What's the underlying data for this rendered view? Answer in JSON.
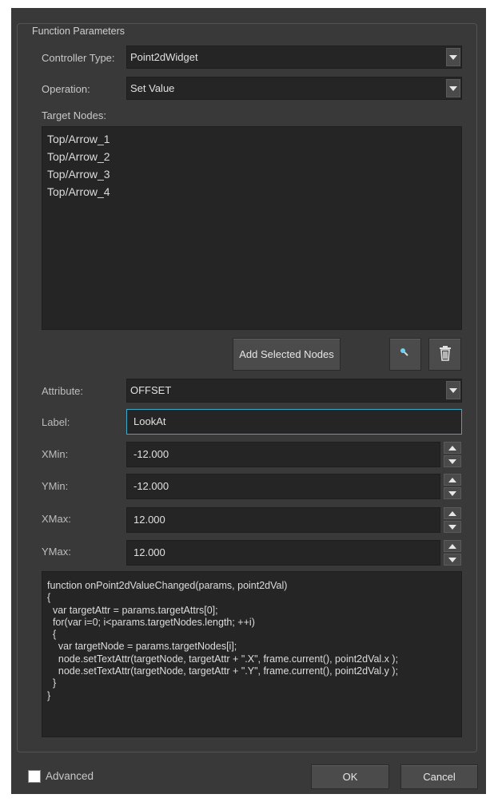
{
  "group": {
    "title": "Function Parameters"
  },
  "controller_type": {
    "label": "Controller Type:",
    "value": "Point2dWidget"
  },
  "operation": {
    "label": "Operation:",
    "value": "Set Value"
  },
  "target_nodes": {
    "label": "Target Nodes:",
    "items": [
      "Top/Arrow_1",
      "Top/Arrow_2",
      "Top/Arrow_3",
      "Top/Arrow_4"
    ]
  },
  "buttons": {
    "add_selected": "Add Selected Nodes",
    "pick_icon": "eyedropper-icon",
    "delete_icon": "trash-icon"
  },
  "attribute": {
    "label": "Attribute:",
    "value": "OFFSET"
  },
  "label_field": {
    "label": "Label:",
    "value": "LookAt"
  },
  "xmin": {
    "label": "XMin:",
    "value": "-12.000"
  },
  "ymin": {
    "label": "YMin:",
    "value": "-12.000"
  },
  "xmax": {
    "label": "XMax:",
    "value": "12.000"
  },
  "ymax": {
    "label": "YMax:",
    "value": "12.000"
  },
  "script": {
    "code": "function onPoint2dValueChanged(params, point2dVal)\n{\n  var targetAttr = params.targetAttrs[0];\n  for(var i=0; i<params.targetNodes.length; ++i)\n  {\n    var targetNode = params.targetNodes[i];\n    node.setTextAttr(targetNode, targetAttr + \".X\", frame.current(), point2dVal.x );\n    node.setTextAttr(targetNode, targetAttr + \".Y\", frame.current(), point2dVal.y );\n  }\n}"
  },
  "footer": {
    "advanced_label": "Advanced",
    "advanced_checked": false,
    "ok": "OK",
    "cancel": "Cancel"
  },
  "colors": {
    "background": "#393939",
    "field": "#252525",
    "focus": "#3aa8c9"
  }
}
